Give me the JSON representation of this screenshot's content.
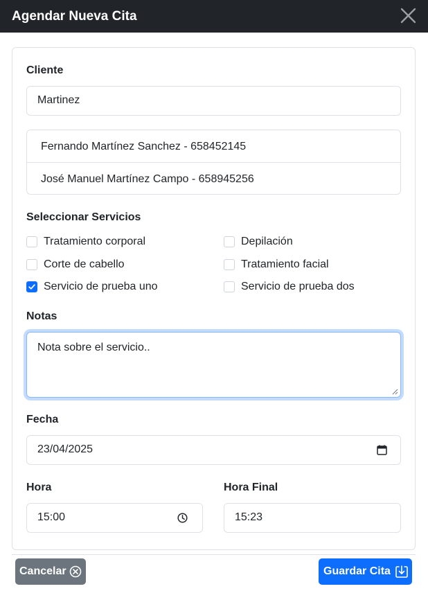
{
  "dialog": {
    "title": "Agendar Nueva Cita"
  },
  "client": {
    "label": "Cliente",
    "search_value": "Martinez",
    "suggestions": [
      {
        "text": "Fernando Martínez Sanchez - 658452145"
      },
      {
        "text": "José Manuel Martínez Campo - 658945256"
      }
    ]
  },
  "services": {
    "label": "Seleccionar Servicios",
    "items": [
      {
        "label": "Tratamiento corporal",
        "checked": false
      },
      {
        "label": "Depilación",
        "checked": false
      },
      {
        "label": "Corte de cabello",
        "checked": false
      },
      {
        "label": "Tratamiento facial",
        "checked": false
      },
      {
        "label": "Servicio de prueba uno",
        "checked": true
      },
      {
        "label": "Servicio de prueba dos",
        "checked": false
      }
    ]
  },
  "notes": {
    "label": "Notas",
    "value": "Nota sobre el servicio.."
  },
  "date": {
    "label": "Fecha",
    "value": "23/04/2025"
  },
  "time": {
    "start_label": "Hora",
    "start_value": "15:00",
    "end_label": "Hora Final",
    "end_value": "15:23"
  },
  "footer": {
    "cancel_label": "Cancelar",
    "save_label": "Guardar Cita"
  },
  "colors": {
    "header_bg": "#212529",
    "primary": "#0d6efd",
    "secondary": "#6c757d",
    "border": "#dee2e6"
  },
  "icons": {
    "close": "close-icon",
    "calendar": "calendar-icon",
    "clock": "clock-icon",
    "cancel": "circle-x-icon",
    "save": "download-box-icon",
    "check": "check-icon"
  }
}
